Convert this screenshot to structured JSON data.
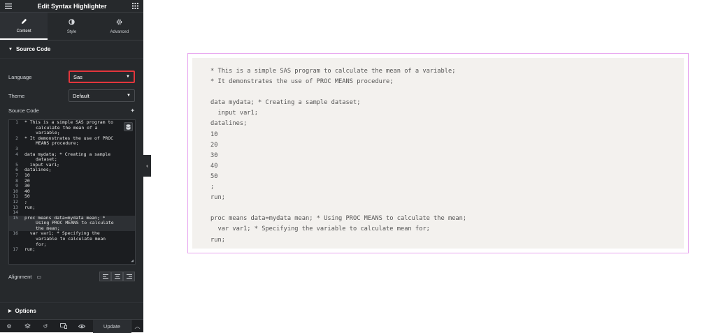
{
  "header": {
    "title": "Edit Syntax Highlighter",
    "menu_icon": "hamburger-icon",
    "apps_icon": "grid-icon"
  },
  "tabs": [
    {
      "label": "Content",
      "icon": "pencil-icon",
      "active": true
    },
    {
      "label": "Style",
      "icon": "half-circle-icon",
      "active": false
    },
    {
      "label": "Advanced",
      "icon": "gear-icon",
      "active": false
    }
  ],
  "section": {
    "title": "Source Code"
  },
  "fields": {
    "language_label": "Language",
    "language_value": "Sas",
    "theme_label": "Theme",
    "theme_value": "Default",
    "source_code_label": "Source Code",
    "alignment_label": "Alignment"
  },
  "editor": {
    "lines": [
      {
        "num": "1",
        "text": "* This is a simple SAS program to calculate the mean of a variable;"
      },
      {
        "num": "2",
        "text": "* It demonstrates the use of PROC MEANS procedure;"
      },
      {
        "num": "3",
        "text": ""
      },
      {
        "num": "4",
        "text": "data mydata; * Creating a sample dataset;"
      },
      {
        "num": "5",
        "text": "  input var1;"
      },
      {
        "num": "6",
        "text": "datalines;"
      },
      {
        "num": "7",
        "text": "10"
      },
      {
        "num": "8",
        "text": "20"
      },
      {
        "num": "9",
        "text": "30"
      },
      {
        "num": "10",
        "text": "40"
      },
      {
        "num": "11",
        "text": "50"
      },
      {
        "num": "12",
        "text": ";"
      },
      {
        "num": "13",
        "text": "run;"
      },
      {
        "num": "14",
        "text": ""
      },
      {
        "num": "15",
        "text": "proc means data=mydata mean; * Using PROC MEANS to calculate the mean;"
      },
      {
        "num": "16",
        "text": "  var var1; * Specifying the variable to calculate mean for;"
      },
      {
        "num": "17",
        "text": "run;"
      }
    ]
  },
  "options": {
    "title": "Options"
  },
  "footer": {
    "update_label": "Update"
  },
  "preview": {
    "lines": [
      "* This is a simple SAS program to calculate the mean of a variable;",
      "* It demonstrates the use of PROC MEANS procedure;",
      "",
      "data mydata; * Creating a sample dataset;",
      "  input var1;",
      "datalines;",
      "10",
      "20",
      "30",
      "40",
      "50",
      ";",
      "run;",
      "",
      "proc means data=mydata mean; * Using PROC MEANS to calculate the mean;",
      "  var var1; * Specifying the variable to calculate mean for;",
      "run;"
    ]
  },
  "colors": {
    "sidebar_bg": "#26292c",
    "highlight_border": "#e2363c",
    "preview_border": "#e8a6ef",
    "preview_bg": "#f3f1ee"
  }
}
